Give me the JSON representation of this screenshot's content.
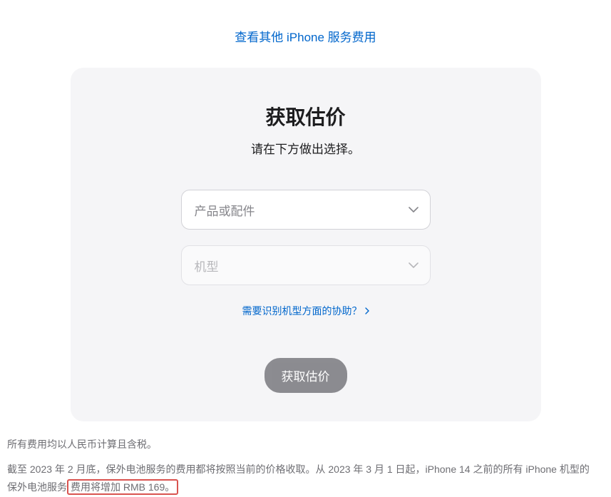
{
  "topLink": {
    "label": "查看其他 iPhone 服务费用"
  },
  "card": {
    "title": "获取估价",
    "subtitle": "请在下方做出选择。",
    "select1": {
      "placeholder": "产品或配件"
    },
    "select2": {
      "placeholder": "机型"
    },
    "helpLink": {
      "label": "需要识别机型方面的协助？"
    },
    "submit": {
      "label": "获取估价"
    }
  },
  "footer": {
    "line1": "所有费用均以人民币计算且含税。",
    "line2_pre": "截至 2023 年 2 月底，保外电池服务的费用都将按照当前的价格收取。从 2023 年 3 月 1 日起，iPhone 14 之前的所有 iPhone 机型的保外电池服务",
    "line2_highlight": "费用将增加 RMB 169。"
  }
}
